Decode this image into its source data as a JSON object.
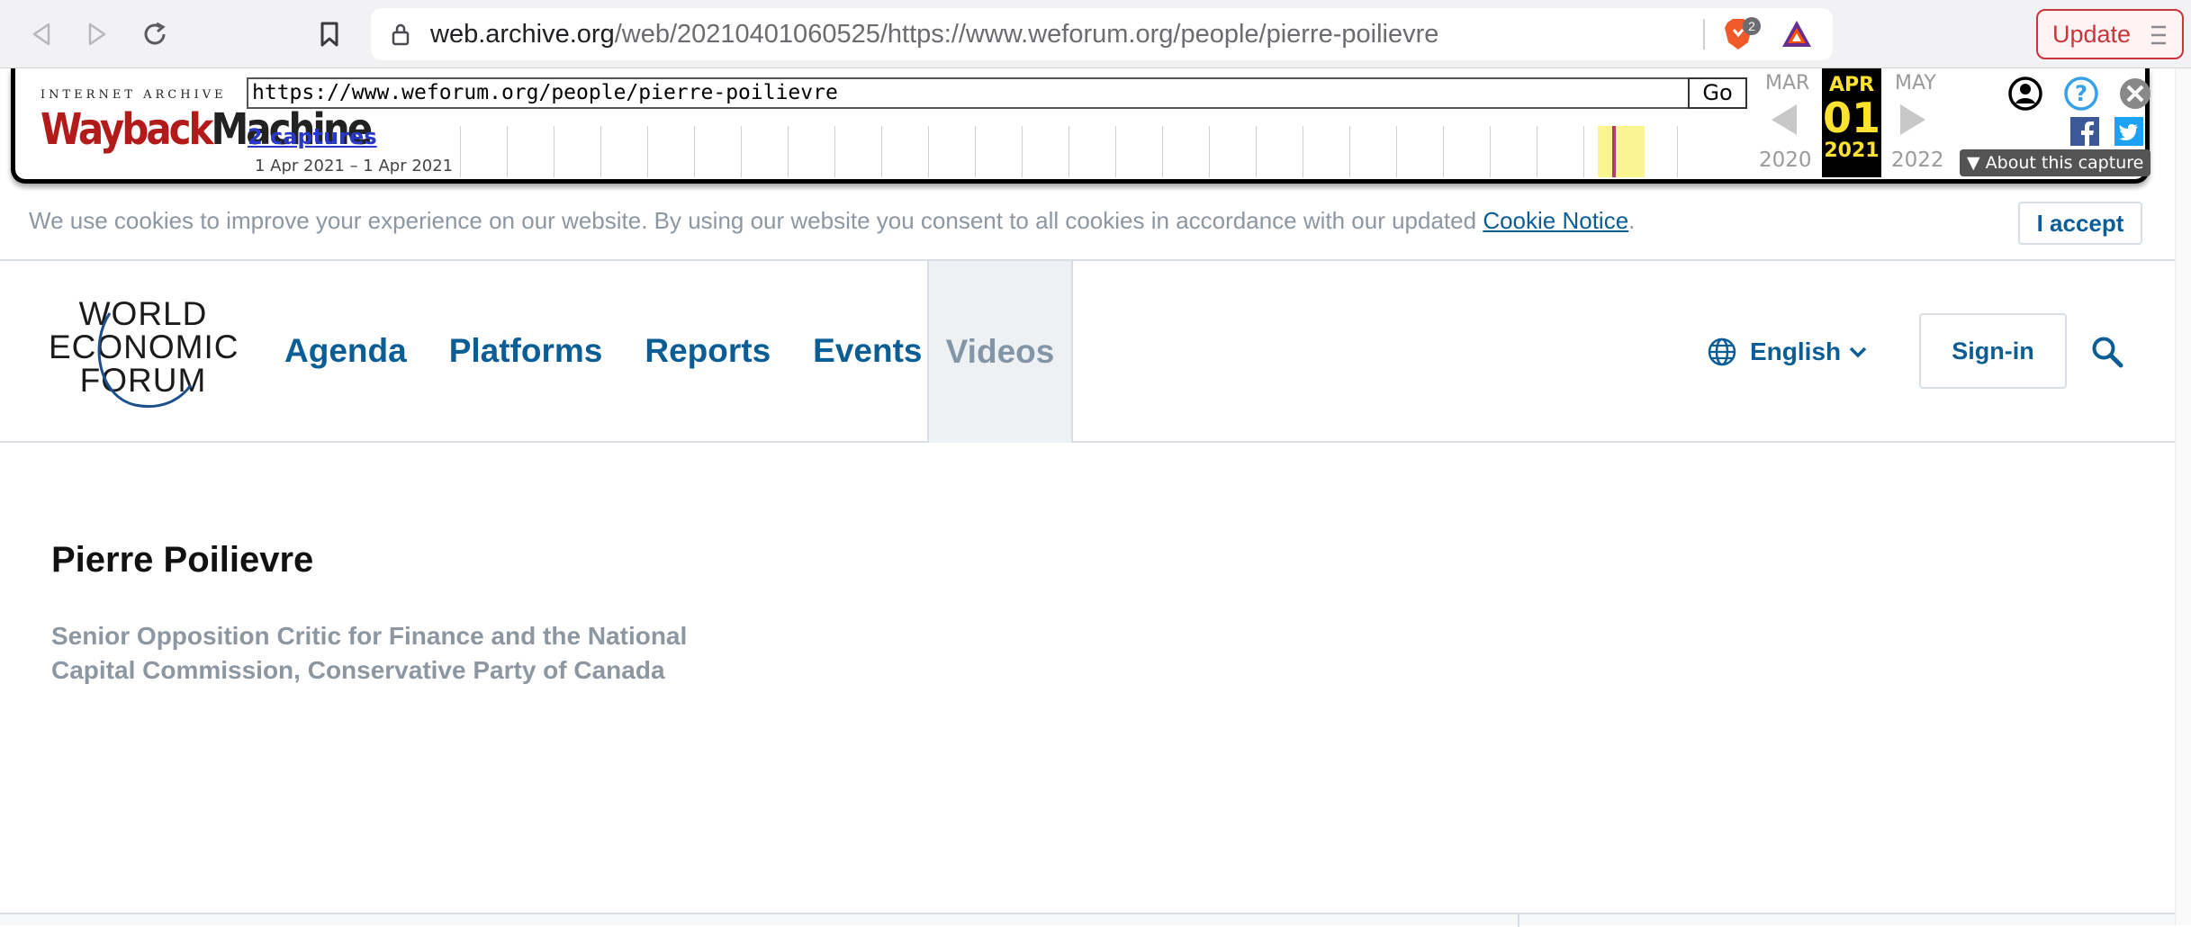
{
  "browser": {
    "url_host": "web.archive.org",
    "url_rest": "/web/20210401060525/https://www.weforum.org/people/pierre-poilievre",
    "shield_count": "2",
    "update_label": "Update"
  },
  "wayback": {
    "logo_top": "INTERNET ARCHIVE",
    "logo_wayback": "Wayback",
    "logo_machine": "Machine",
    "url_value": "https://www.weforum.org/people/pierre-poilievre",
    "go_label": "Go",
    "captures_label": "2 captures",
    "captures_range": "1 Apr 2021 – 1 Apr 2021",
    "prev_month": "MAR",
    "cur_month": "APR",
    "next_month": "MAY",
    "cur_day": "01",
    "prev_year": "2020",
    "cur_year": "2021",
    "next_year": "2022",
    "about_label": "About this capture"
  },
  "cookie": {
    "text": "We use cookies to improve your experience on our website. By using our website you consent to all cookies in accordance with our updated ",
    "link": "Cookie Notice",
    "suffix": ".",
    "accept_label": "I accept"
  },
  "header": {
    "logo_lines": [
      "WORLD",
      "ECONOMIC",
      "FORUM"
    ],
    "nav": [
      "Agenda",
      "Platforms",
      "Reports",
      "Events"
    ],
    "nav_active": "Videos",
    "language": "English",
    "signin_label": "Sign-in"
  },
  "person": {
    "name": "Pierre Poilievre",
    "title": "Senior Opposition Critic for Finance and the National Capital Commission, Conservative Party of Canada"
  },
  "colors": {
    "brand_blue": "#0b5d96",
    "muted_gray": "#8c97a2",
    "wayback_yellow": "#ffe12f",
    "update_red": "#c9353b"
  }
}
